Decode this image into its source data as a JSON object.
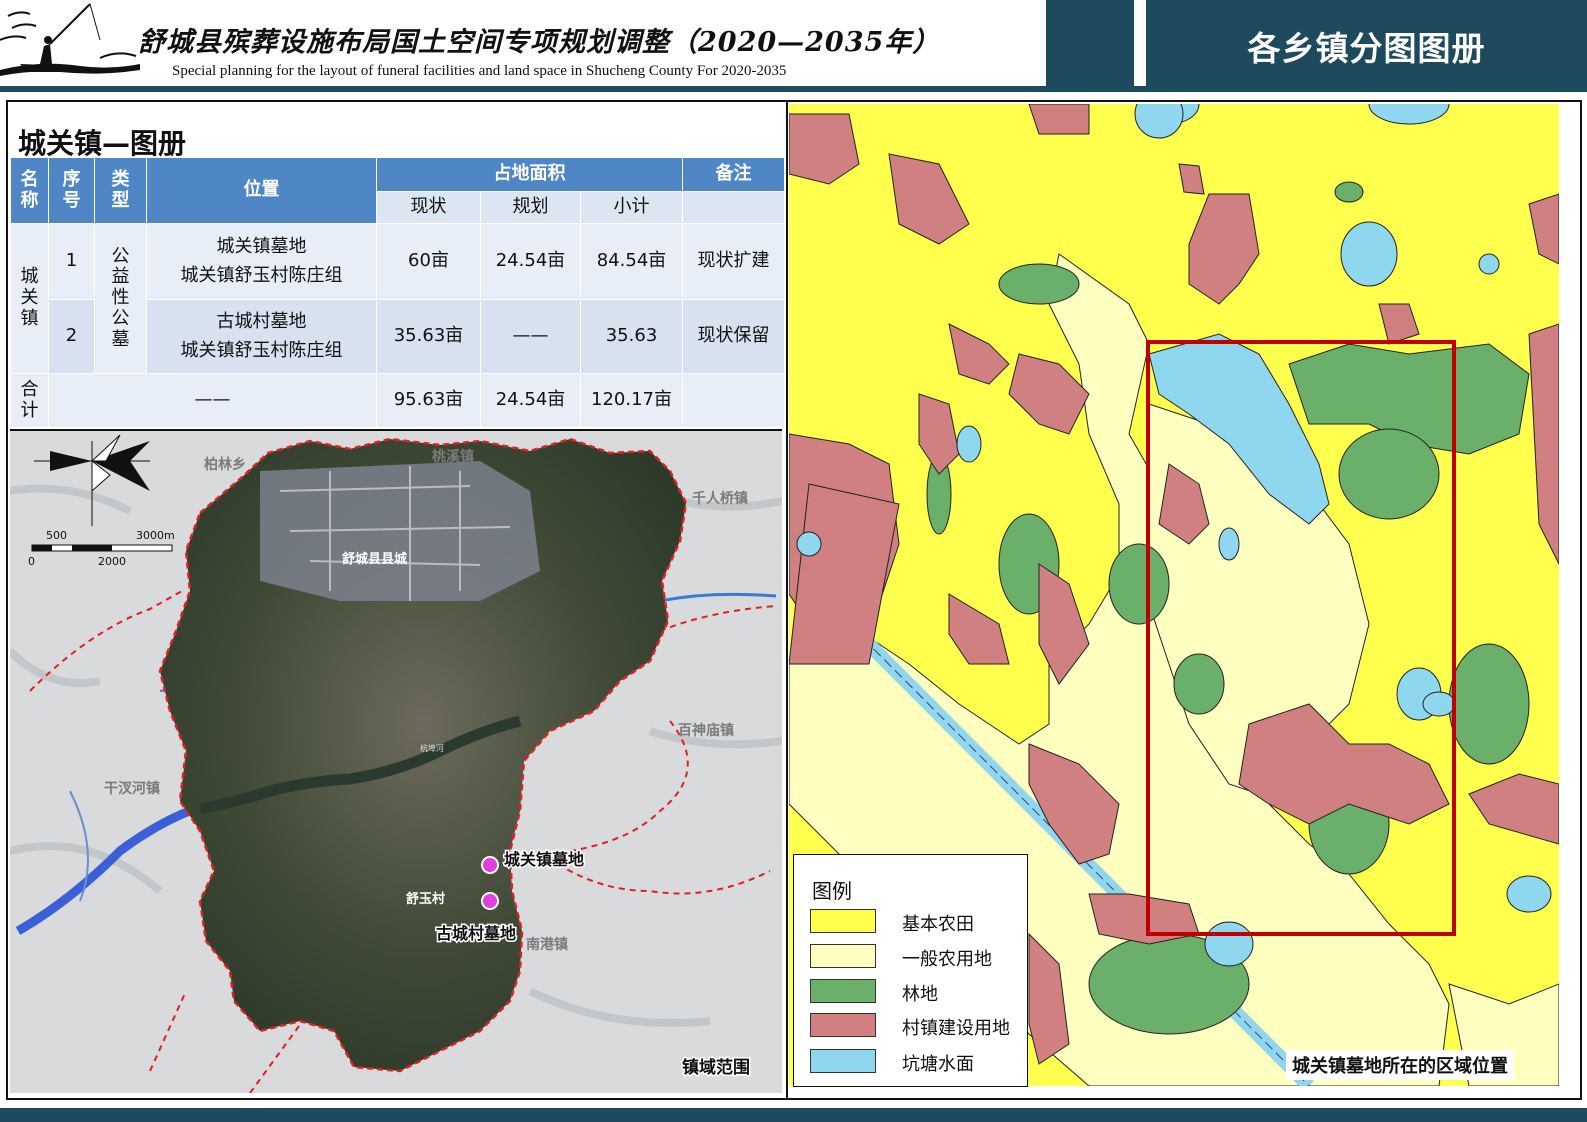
{
  "header": {
    "title_cn": "舒城县殡葬设施布局国土空间专项规划调整（2020—2035年）",
    "title_en": "Special planning for the layout of funeral facilities and land space in Shucheng County For 2020-2035",
    "atlas_label": "各乡镇分图图册",
    "brand_color": "#1d4a5c"
  },
  "table": {
    "title": "城关镇—图册",
    "headers": {
      "name": "名称",
      "seq": "序号",
      "type": "类型",
      "location": "位置",
      "area": "占地面积",
      "current": "现状",
      "planned": "规划",
      "subtotal": "小计",
      "remark": "备注"
    },
    "town": "城关镇",
    "type_value": "公益性公墓",
    "rows": [
      {
        "seq": "1",
        "location_1": "城关镇墓地",
        "location_2": "城关镇舒玉村陈庄组",
        "current": "60亩",
        "planned": "24.54亩",
        "subtotal": "84.54亩",
        "remark": "现状扩建"
      },
      {
        "seq": "2",
        "location_1": "古城村墓地",
        "location_2": "城关镇舒玉村陈庄组",
        "current": "35.63亩",
        "planned": "——",
        "subtotal": "35.63",
        "remark": "现状保留"
      }
    ],
    "total": {
      "label": "合计",
      "location": "——",
      "current": "95.63亩",
      "planned": "24.54亩",
      "subtotal": "120.17亩",
      "remark": ""
    }
  },
  "satellite_map": {
    "scale_labels": [
      "500",
      "3000m",
      "0",
      "2000"
    ],
    "neighbors": [
      "柏林乡",
      "桃溪镇",
      "千人桥镇",
      "百神庙镇",
      "干汊河镇",
      "南港镇"
    ],
    "county_seat": "舒城县县城",
    "village": "舒玉村",
    "river": "杭埠河",
    "cemeteries": [
      "城关镇墓地",
      "古城村墓地"
    ],
    "caption": "镇域范围",
    "marker_color": "#e040e0",
    "boundary_color": "#e02020"
  },
  "landuse_map": {
    "legend_title": "图例",
    "legend": [
      {
        "label": "基本农田",
        "color": "#ffff4d"
      },
      {
        "label": "一般农用地",
        "color": "#ffffc0"
      },
      {
        "label": "林地",
        "color": "#6aaf6a"
      },
      {
        "label": "村镇建设用地",
        "color": "#d08080"
      },
      {
        "label": "坑塘水面",
        "color": "#8fd7ee"
      }
    ],
    "highlight_color": "#c00000",
    "caption": "城关镇墓地所在的区域位置"
  }
}
